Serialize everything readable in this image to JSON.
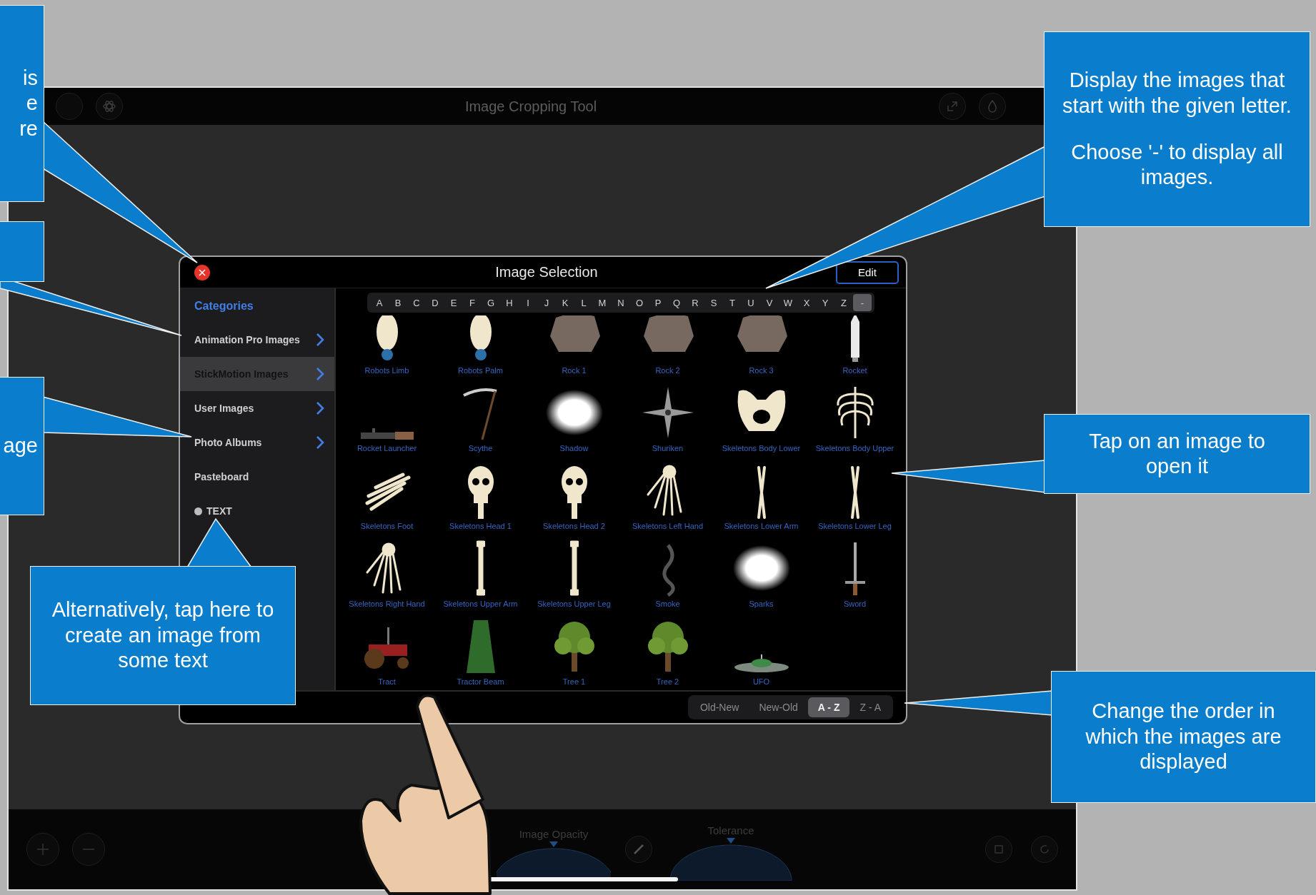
{
  "app": {
    "title": "Image Cropping Tool"
  },
  "dialog": {
    "title": "Image Selection",
    "edit_button": "Edit",
    "sidebar": {
      "heading": "Categories",
      "items": [
        {
          "label": "Animation Pro Images",
          "kind": "folder",
          "selected": false
        },
        {
          "label": "StickMotion Images",
          "kind": "folder",
          "selected": true
        },
        {
          "label": "User Images",
          "kind": "folder",
          "selected": false
        },
        {
          "label": "Photo Albums",
          "kind": "folder",
          "selected": false
        },
        {
          "label": "Pasteboard",
          "kind": "plain",
          "selected": false
        },
        {
          "label": "TEXT",
          "kind": "text",
          "selected": false
        }
      ]
    },
    "letters": [
      {
        "label": "A",
        "selected": false
      },
      {
        "label": "B",
        "selected": false
      },
      {
        "label": "C",
        "selected": false
      },
      {
        "label": "D",
        "selected": false
      },
      {
        "label": "E",
        "selected": false
      },
      {
        "label": "F",
        "selected": false
      },
      {
        "label": "G",
        "selected": false
      },
      {
        "label": "H",
        "selected": false
      },
      {
        "label": "I",
        "selected": false
      },
      {
        "label": "J",
        "selected": false
      },
      {
        "label": "K",
        "selected": false
      },
      {
        "label": "L",
        "selected": false
      },
      {
        "label": "M",
        "selected": false
      },
      {
        "label": "N",
        "selected": false
      },
      {
        "label": "O",
        "selected": false
      },
      {
        "label": "P",
        "selected": false
      },
      {
        "label": "Q",
        "selected": false
      },
      {
        "label": "R",
        "selected": false
      },
      {
        "label": "S",
        "selected": false
      },
      {
        "label": "T",
        "selected": false
      },
      {
        "label": "U",
        "selected": false
      },
      {
        "label": "V",
        "selected": false
      },
      {
        "label": "W",
        "selected": false
      },
      {
        "label": "X",
        "selected": false
      },
      {
        "label": "Y",
        "selected": false
      },
      {
        "label": "Z",
        "selected": false
      },
      {
        "label": "-",
        "selected": true
      }
    ],
    "images": [
      {
        "label": "Robots Limb",
        "kind": "egg"
      },
      {
        "label": "Robots Palm",
        "kind": "egg"
      },
      {
        "label": "Rock 1",
        "kind": "rock"
      },
      {
        "label": "Rock 2",
        "kind": "rock"
      },
      {
        "label": "Rock 3",
        "kind": "rock"
      },
      {
        "label": "Rocket",
        "kind": "rocket"
      },
      {
        "label": "Rocket Launcher",
        "kind": "tube"
      },
      {
        "label": "Scythe",
        "kind": "scythe"
      },
      {
        "label": "Shadow",
        "kind": "glow"
      },
      {
        "label": "Shuriken",
        "kind": "shuriken"
      },
      {
        "label": "Skeletons Body Lower",
        "kind": "pelvis"
      },
      {
        "label": "Skeletons Body Upper",
        "kind": "ribs"
      },
      {
        "label": "Skeletons Foot",
        "kind": "foot"
      },
      {
        "label": "Skeletons Head 1",
        "kind": "skull"
      },
      {
        "label": "Skeletons Head 2",
        "kind": "skull"
      },
      {
        "label": "Skeletons Left Hand",
        "kind": "hand"
      },
      {
        "label": "Skeletons Lower Arm",
        "kind": "bones"
      },
      {
        "label": "Skeletons Lower Leg",
        "kind": "bones"
      },
      {
        "label": "Skeletons Right Hand",
        "kind": "hand"
      },
      {
        "label": "Skeletons Upper Arm",
        "kind": "bone"
      },
      {
        "label": "Skeletons Upper Leg",
        "kind": "bone"
      },
      {
        "label": "Smoke",
        "kind": "smoke"
      },
      {
        "label": "Sparks",
        "kind": "glow"
      },
      {
        "label": "Sword",
        "kind": "sword"
      },
      {
        "label": "Tract",
        "kind": "tractor"
      },
      {
        "label": "Tractor Beam",
        "kind": "beam"
      },
      {
        "label": "Tree 1",
        "kind": "tree"
      },
      {
        "label": "Tree 2",
        "kind": "tree"
      },
      {
        "label": "UFO",
        "kind": "ufo"
      }
    ],
    "sort_options": [
      {
        "label": "Old-New",
        "selected": false
      },
      {
        "label": "New-Old",
        "selected": false
      },
      {
        "label": "A - Z",
        "selected": true
      },
      {
        "label": "Z - A",
        "selected": false
      }
    ]
  },
  "bottom_bar": {
    "labels": [
      "Image Opacity",
      "Tolerance"
    ]
  },
  "callouts": [
    {
      "clipped": true,
      "paragraphs": [
        "is",
        "e",
        "re"
      ]
    },
    {
      "clipped": true
    },
    {
      "clipped": true,
      "paragraphs": [
        "age"
      ]
    },
    {
      "clipped": false,
      "paragraphs": [
        "Alternatively, tap here to create an image from some text"
      ]
    },
    {
      "clipped": false,
      "paragraphs": [
        "Display the images that start with the given letter.",
        "Choose '-' to display all images."
      ]
    },
    {
      "clipped": false,
      "paragraphs": [
        "Tap on an image to open it"
      ]
    },
    {
      "clipped": false,
      "paragraphs": [
        "Change the order in which the images are displayed"
      ]
    }
  ]
}
